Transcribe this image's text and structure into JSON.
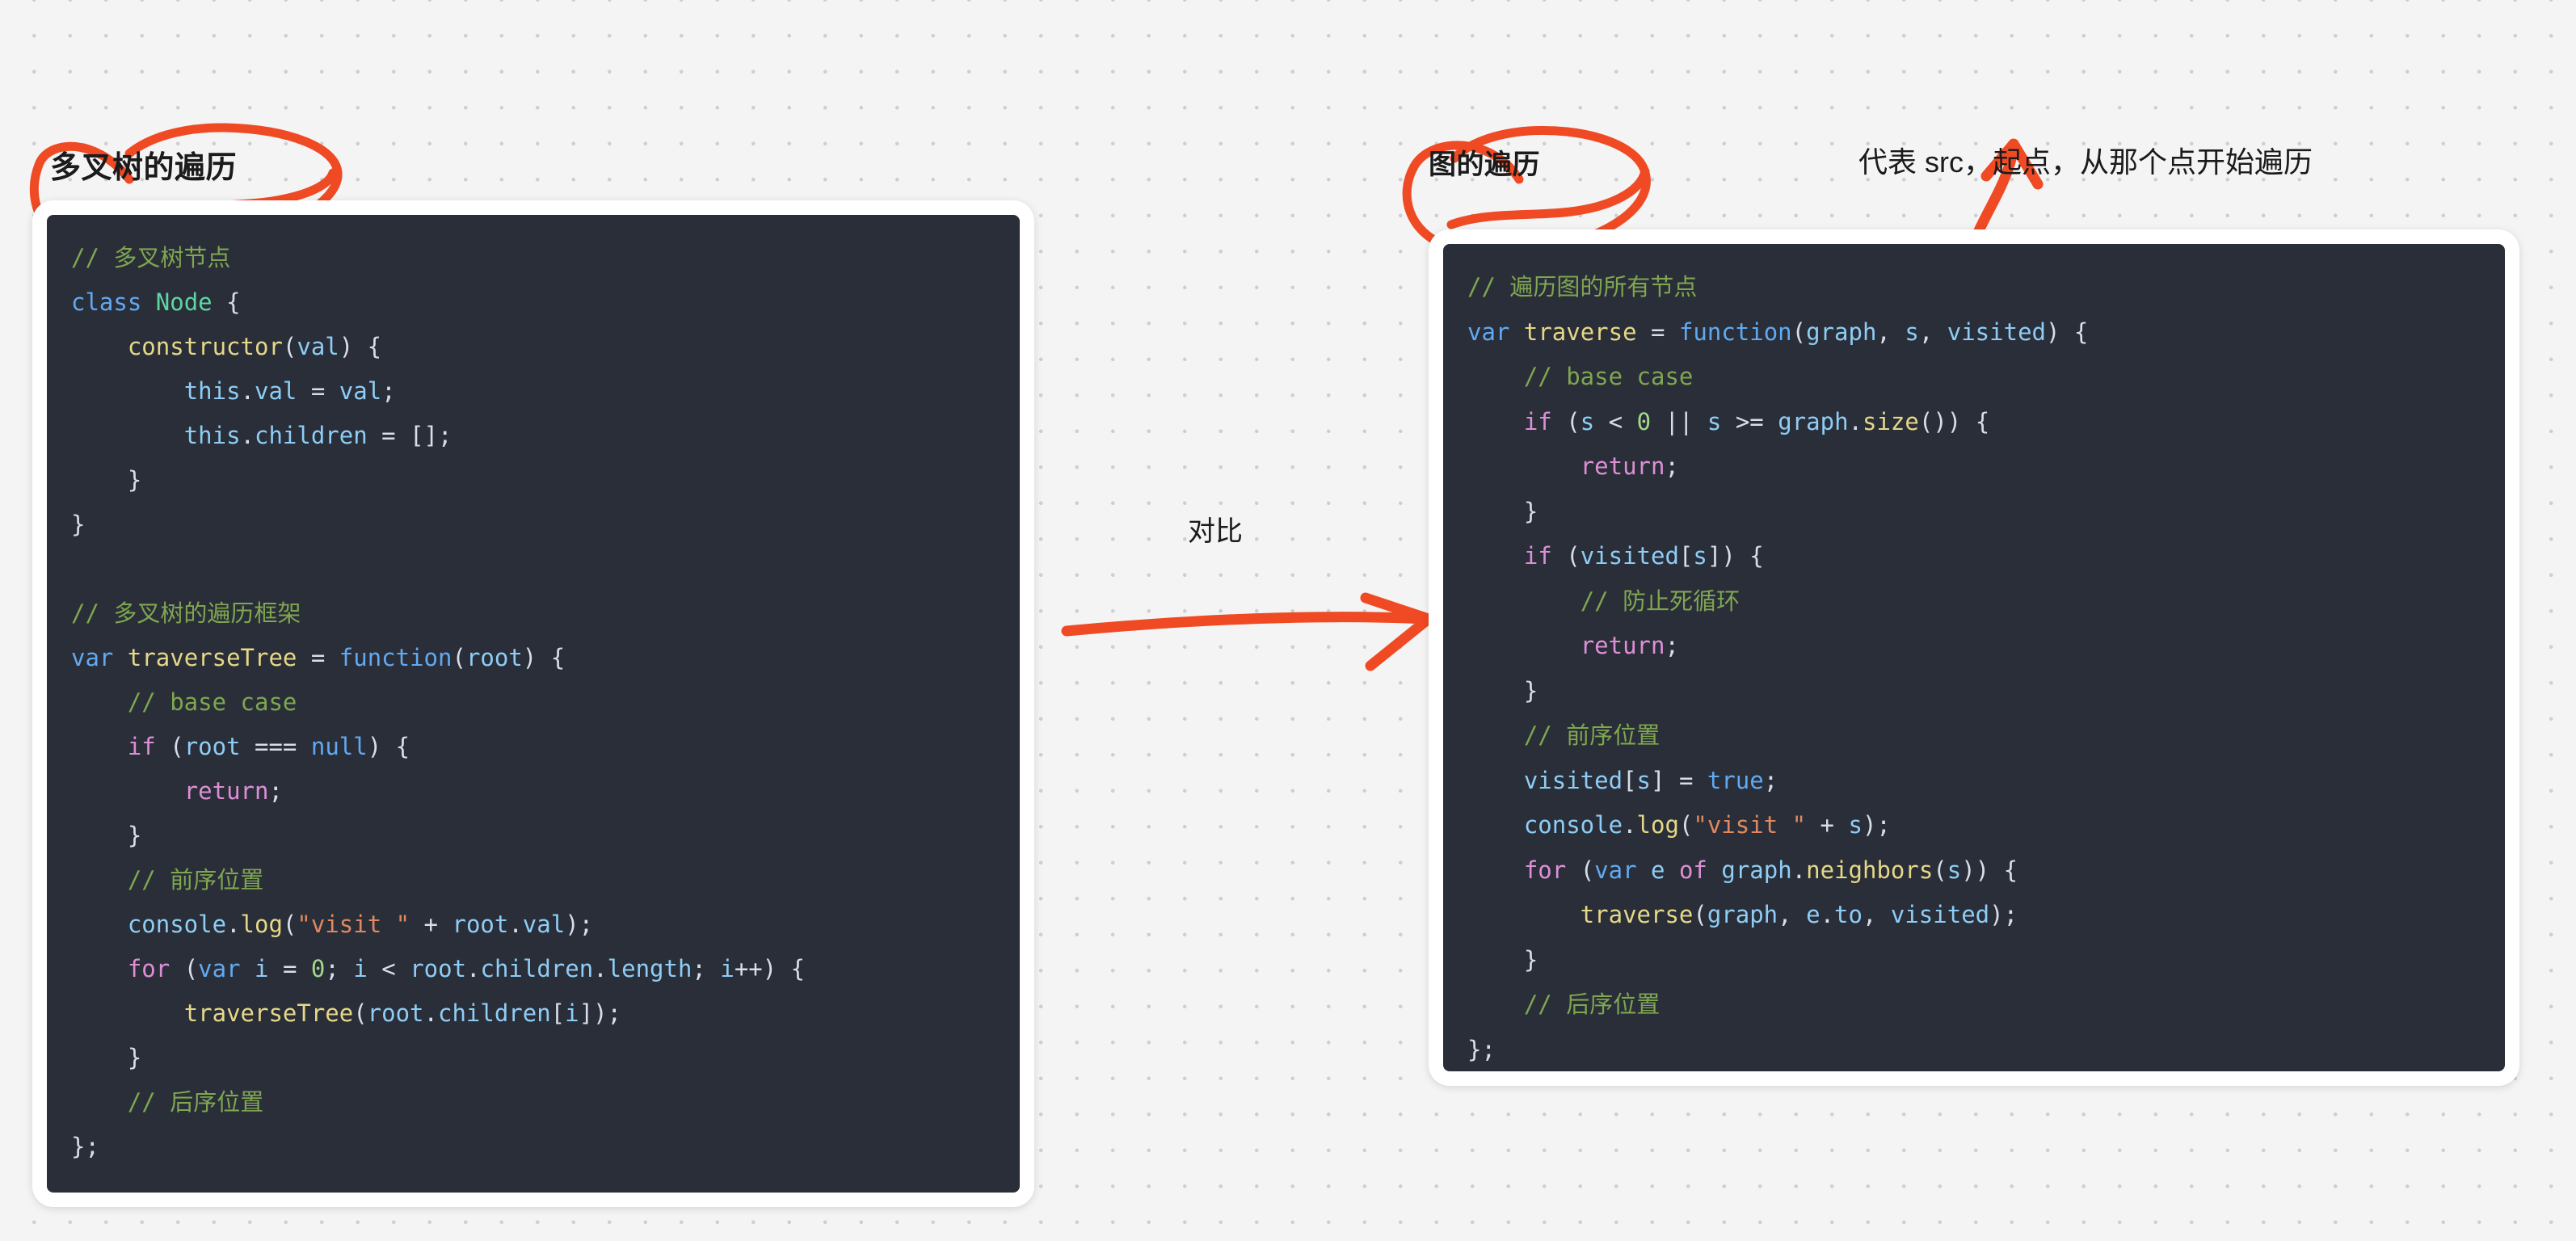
{
  "canvas": {
    "background_color": "#f4f4f4",
    "dot_color": "#cfcfcf",
    "annotation_color": "#ef4a23"
  },
  "titles": {
    "left": "多叉树的遍历",
    "right": "图的遍历"
  },
  "annotations": {
    "src_note": "代表 src，起点，从那个点开始遍历",
    "compare": "对比"
  },
  "left_card": {
    "language": "javascript",
    "theme": "one-dark",
    "lines": [
      "// 多叉树节点",
      "class Node {",
      "    constructor(val) {",
      "        this.val = val;",
      "        this.children = [];",
      "    }",
      "}",
      "",
      "// 多叉树的遍历框架",
      "var traverseTree = function(root) {",
      "    // base case",
      "    if (root === null) {",
      "        return;",
      "    }",
      "    // 前序位置",
      "    console.log(\"visit \" + root.val);",
      "    for (var i = 0; i < root.children.length; i++) {",
      "        traverseTree(root.children[i]);",
      "    }",
      "    // 后序位置",
      "};"
    ],
    "underlined_phrases": [
      "// 前序位置",
      "// 后序位置"
    ]
  },
  "right_card": {
    "language": "javascript",
    "theme": "one-dark",
    "lines": [
      "// 遍历图的所有节点",
      "var traverse = function(graph, s, visited) {",
      "    // base case",
      "    if (s < 0 || s >= graph.size()) {",
      "        return;",
      "    }",
      "    if (visited[s]) {",
      "        // 防止死循环",
      "        return;",
      "    }",
      "    // 前序位置",
      "    visited[s] = true;",
      "    console.log(\"visit \" + s);",
      "    for (var e of graph.neighbors(s)) {",
      "        traverse(graph, e.to, visited);",
      "    }",
      "    // 后序位置",
      "};"
    ],
    "underlined_phrases": [
      "graph",
      "s",
      "// 前序位置",
      "graph.neighbors(s)",
      "// 后序位置"
    ]
  }
}
